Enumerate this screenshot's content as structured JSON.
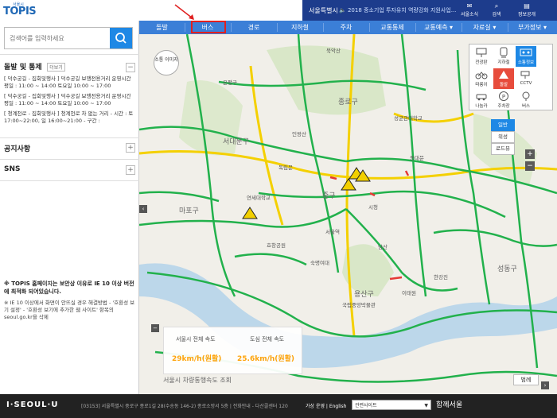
{
  "header": {
    "logo_small": "서울시",
    "logo_text": "TOPIS",
    "seoul_label": "서울특별시",
    "news_ticker": "2018 중소기업 투자유치 역량강화 지원사업...",
    "icons": [
      {
        "name": "seoul-news-icon",
        "label": "서울소식"
      },
      {
        "name": "sitemap-icon",
        "label": "검색"
      },
      {
        "name": "info-icon",
        "label": "정보공개"
      }
    ]
  },
  "nav": {
    "items": [
      "돌발",
      "버스",
      "경로",
      "지하철",
      "주차",
      "교통통제",
      "교통예측",
      "자료실",
      "부가정보"
    ],
    "selected": "버스"
  },
  "sidebar": {
    "search_placeholder": "검색어를 입력하세요",
    "incidents_title": "돌발 및 통제",
    "incidents_more": "더보기",
    "incidents": [
      "[ 덕수궁길 - 집회및행사 ] 덕수궁길 보행전용거리 운영시간 평일 : 11:00 ~ 14:00 토요일 10:00 ~ 17:00",
      "[ 덕수궁길 - 집회및행사 ] 덕수궁길 보행전용거리 운영시간 평일 : 11:00 ~ 14:00 토요일 10:00 ~ 17:00",
      "[ 청계천로 - 집회및행사 ] 청계천로 차 없는 거리 - 시간 : 토 17:00~22:00, 일 16:00~21:00 - 구간 :"
    ],
    "notices_title": "공지사항",
    "sns_title": "SNS",
    "notice_bold": "※ TOPIS 홈페이지는 보안상 이유로 IE 10 이상 버전에 최적화 되어있습니다.",
    "notice_text": "※ IE 10 이상에서 화면이 안뜨실 경우 해결방법 - '호환성 보기 설정' - '호환성 보기에 추가한 웹 사이트' 항목의 seoul.go.kr을 삭제"
  },
  "map": {
    "sat_button": "소통 이미지",
    "labels": [
      "종로구",
      "서대문구",
      "마포구",
      "용산구",
      "중구",
      "성동구",
      "은평구",
      "독립문",
      "서울역",
      "시청",
      "인왕산",
      "북악산",
      "연세대학교",
      "국립중앙박물관",
      "이태원",
      "한강진",
      "남산",
      "동대문",
      "성균관대학교",
      "숙명여대",
      "효창공원"
    ],
    "cctv_panel": [
      {
        "label": "전광판",
        "icon": "billboard-icon"
      },
      {
        "label": "지하철",
        "icon": "subway-icon"
      },
      {
        "label": "소통정보",
        "icon": "traffic-info-icon",
        "selected": true
      },
      {
        "label": "따릉이",
        "icon": "bike-icon"
      },
      {
        "label": "돌발",
        "icon": "incident-icon",
        "alert": true
      },
      {
        "label": "CCTV",
        "icon": "cctv-icon"
      },
      {
        "label": "나눔카",
        "icon": "car-share-icon"
      },
      {
        "label": "주차장",
        "icon": "parking-icon"
      },
      {
        "label": "버스",
        "icon": "bus-icon"
      }
    ],
    "map_types": [
      {
        "label": "일반",
        "selected": true
      },
      {
        "label": "위성"
      },
      {
        "label": "로드뷰"
      }
    ],
    "speed": {
      "city_label": "서울시 전체 속도",
      "city_value": "29km/h(원활)",
      "downtown_label": "도심 전체 속도",
      "downtown_value": "25.6km/h(원활)",
      "link": "서울시 차량통행속도 조회"
    },
    "legend_button": "범례"
  },
  "footer": {
    "logo": "I·SEOUL·U",
    "address": "[03153] 서울특별시 중로구 종로1길 28(수송동 146-2) 종로소방서 5층  |  전화안내 - 다산콜센터 120",
    "links": "가상 운영 | English",
    "select_label": "관련사이트",
    "slogan": "함께서울"
  }
}
